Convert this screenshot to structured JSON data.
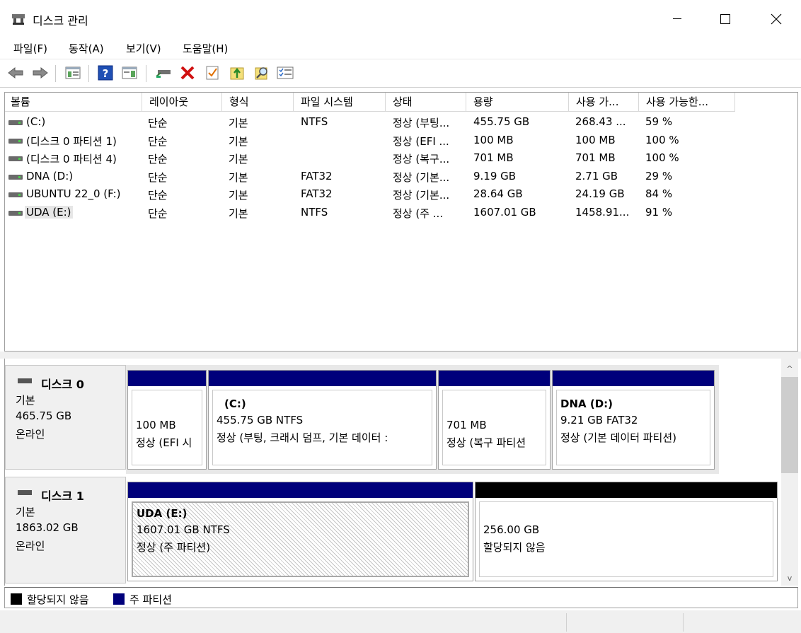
{
  "window": {
    "title": "디스크 관리",
    "controls": {
      "minimize": "—",
      "maximize": "☐",
      "close": "✕"
    }
  },
  "menu": [
    {
      "label": "파일(F)"
    },
    {
      "label": "동작(A)"
    },
    {
      "label": "보기(V)"
    },
    {
      "label": "도움말(H)"
    }
  ],
  "toolbar": {
    "icons": [
      "back-arrow-icon",
      "forward-arrow-icon",
      "console-tree-icon",
      "help-icon",
      "action-pane-icon",
      "connect-drive-icon",
      "delete-icon",
      "properties-icon",
      "import-disk-icon",
      "find-icon",
      "list-icon"
    ]
  },
  "volume_list": {
    "columns": [
      "볼륨",
      "레이아웃",
      "형식",
      "파일 시스템",
      "상태",
      "용량",
      "사용 가...",
      "사용 가능한..."
    ],
    "rows": [
      {
        "volume": " (C:)",
        "layout": "단순",
        "type": "기본",
        "fs": "NTFS",
        "status": "정상 (부팅...",
        "capacity": "455.75 GB",
        "free": "268.43 ...",
        "pct": "59 %"
      },
      {
        "volume": "(디스크 0 파티션 1)",
        "layout": "단순",
        "type": "기본",
        "fs": "",
        "status": "정상 (EFI ...",
        "capacity": "100 MB",
        "free": "100 MB",
        "pct": "100 %"
      },
      {
        "volume": "(디스크 0 파티션 4)",
        "layout": "단순",
        "type": "기본",
        "fs": "",
        "status": "정상 (복구...",
        "capacity": "701 MB",
        "free": "701 MB",
        "pct": "100 %"
      },
      {
        "volume": "DNA (D:)",
        "layout": "단순",
        "type": "기본",
        "fs": "FAT32",
        "status": "정상 (기본...",
        "capacity": "9.19 GB",
        "free": "2.71 GB",
        "pct": "29 %"
      },
      {
        "volume": "UBUNTU 22_0 (F:)",
        "layout": "단순",
        "type": "기본",
        "fs": "FAT32",
        "status": "정상 (기본...",
        "capacity": "28.64 GB",
        "free": "24.19 GB",
        "pct": "84 %"
      },
      {
        "volume": "UDA (E:)",
        "layout": "단순",
        "type": "기본",
        "fs": "NTFS",
        "status": "정상 (주 ...",
        "capacity": "1607.01 GB",
        "free": "1458.91...",
        "pct": "91 %"
      }
    ]
  },
  "disks": [
    {
      "name": "디스크 0",
      "type": "기본",
      "size": "465.75 GB",
      "state": "온라인",
      "partitions": [
        {
          "title": "",
          "line1": "100 MB",
          "line2": "정상 (EFI 시"
        },
        {
          "title": "(C:)",
          "line1": "455.75 GB NTFS",
          "line2": "정상 (부팅, 크래시 덤프, 기본 데이터 :"
        },
        {
          "title": "",
          "line1": "701 MB",
          "line2": "정상 (복구 파티션"
        },
        {
          "title": "DNA  (D:)",
          "line1": "9.21 GB FAT32",
          "line2": "정상 (기본 데이터 파티션)"
        }
      ]
    },
    {
      "name": "디스크 1",
      "type": "기본",
      "size": "1863.02 GB",
      "state": "온라인",
      "partitions": [
        {
          "title": "UDA  (E:)",
          "line1": "1607.01 GB NTFS",
          "line2": "정상 (주 파티션)"
        },
        {
          "title": "",
          "line1": "256.00 GB",
          "line2": "할당되지 않음"
        }
      ]
    }
  ],
  "legend": [
    {
      "label": "할당되지 않음",
      "color": "#000000"
    },
    {
      "label": "주 파티션",
      "color": "#00007b"
    }
  ],
  "scrollbar": {
    "up": "^",
    "down": "v"
  }
}
